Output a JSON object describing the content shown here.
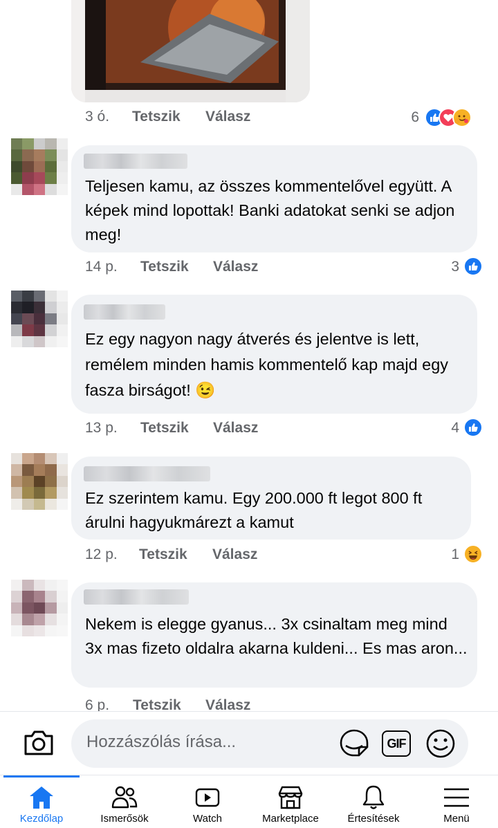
{
  "top_post": {
    "time": "3 ó.",
    "like_label": "Tetszik",
    "reply_label": "Válasz",
    "reaction_count": "6",
    "reactions": [
      "like-icon",
      "heart-icon",
      "hug-icon"
    ]
  },
  "comments": [
    {
      "text": "Teljesen kamu, az összes kommentelővel együtt. A képek mind lopottak! Banki adatokat senki se adjon meg!",
      "time": "14 p.",
      "like_label": "Tetszik",
      "reply_label": "Válasz",
      "reaction_count": "3",
      "reaction": "like-icon"
    },
    {
      "text": "Ez egy nagyon nagy átverés és jelentve is lett, remélem minden hamis kommentelő kap majd egy fasza birságot! 😉",
      "time": "13 p.",
      "like_label": "Tetszik",
      "reply_label": "Válasz",
      "reaction_count": "4",
      "reaction": "like-icon"
    },
    {
      "text": "Ez szerintem kamu. Egy 200.000 ft legot 800 ft árulni hagyukmárezt a kamut",
      "time": "12 p.",
      "like_label": "Tetszik",
      "reply_label": "Válasz",
      "reaction_count": "1",
      "reaction": "haha-icon"
    },
    {
      "text": "Nekem is elegge gyanus... 3x csinaltam meg mind 3x mas fizeto oldalra akarna kuldeni... Es mas aron...",
      "time": "6 p.",
      "like_label": "Tetszik",
      "reply_label": "Válasz"
    }
  ],
  "composer": {
    "placeholder": "Hozzászólás írása...",
    "gif_label": "GIF",
    "icons": [
      "camera-icon",
      "sticker-icon",
      "gif-icon",
      "emoji-icon"
    ]
  },
  "tabs": [
    {
      "label": "Kezdőlap",
      "icon": "home-icon",
      "active": true
    },
    {
      "label": "Ismerősök",
      "icon": "friends-icon",
      "active": false
    },
    {
      "label": "Watch",
      "icon": "watch-icon",
      "active": false
    },
    {
      "label": "Marketplace",
      "icon": "marketplace-icon",
      "active": false
    },
    {
      "label": "Értesítések",
      "icon": "bell-icon",
      "active": false
    },
    {
      "label": "Menü",
      "icon": "menu-icon",
      "active": false
    }
  ],
  "colors": {
    "accent": "#1877f2",
    "bubble": "#f0f2f5",
    "meta_text": "#65676b",
    "heart": "#f33e58",
    "emoji": "#f7b125"
  }
}
